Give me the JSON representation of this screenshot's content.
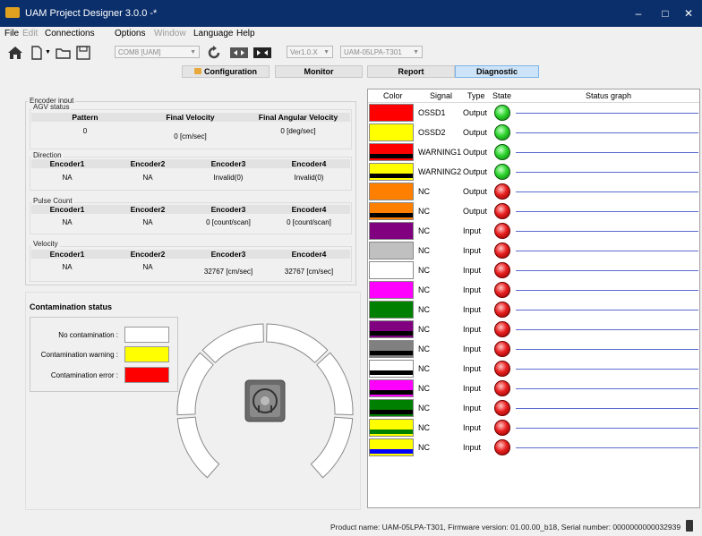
{
  "window": {
    "title": "UAM Project Designer 3.0.0 -*",
    "minimize": "–",
    "maximize": "□",
    "close": "✕"
  },
  "menu": {
    "file": "File",
    "edit": "Edit",
    "connections": "Connections",
    "options": "Options",
    "window": "Window",
    "language": "Language",
    "help": "Help"
  },
  "toolbar": {
    "com_port": "COM8 [UAM]",
    "version": "Ver1.0.X",
    "device": "UAM-05LPA-T301",
    "icons": [
      "home-icon",
      "new-file-icon",
      "open-folder-icon",
      "save-icon",
      "refresh-icon",
      "disconnect-icon",
      "connect-icon"
    ]
  },
  "tabs": {
    "configuration": "Configuration",
    "monitor": "Monitor",
    "report": "Report",
    "diagnostic": "Diagnostic",
    "active": "diagnostic"
  },
  "encoder": {
    "title": "Encoder input",
    "agv": {
      "title": "AGV status",
      "headers": {
        "pattern": "Pattern",
        "velocity": "Final Velocity",
        "angular": "Final Angular Velocity"
      },
      "values": {
        "pattern": "0",
        "velocity": "0 [cm/sec]",
        "angular": "0 [deg/sec]"
      }
    },
    "direction": {
      "title": "Direction",
      "headers": [
        "Encoder1",
        "Encoder2",
        "Encoder3",
        "Encoder4"
      ],
      "values": [
        "NA",
        "NA",
        "Invalid(0)",
        "Invalid(0)"
      ]
    },
    "pulse": {
      "title": "Pulse Count",
      "headers": [
        "Encoder1",
        "Encoder2",
        "Encoder3",
        "Encoder4"
      ],
      "values": [
        "NA",
        "NA",
        "0 [count/scan]",
        "0 [count/scan]"
      ]
    },
    "velocity": {
      "title": "Velocity",
      "headers": [
        "Encoder1",
        "Encoder2",
        "Encoder3",
        "Encoder4"
      ],
      "values": [
        "NA",
        "NA",
        "32767 [cm/sec]",
        "32767 [cm/sec]"
      ]
    }
  },
  "contamination": {
    "title": "Contamination status",
    "legend": [
      {
        "label": "No contamination :",
        "color": "#ffffff"
      },
      {
        "label": "Contamination warning :",
        "color": "#ffff00"
      },
      {
        "label": "Contamination error :",
        "color": "#ff0000"
      }
    ]
  },
  "io_table": {
    "headers": {
      "color": "Color",
      "signal": "Signal",
      "type": "Type",
      "state": "State",
      "graph": "Status graph"
    },
    "rows": [
      {
        "color": "#ff0000",
        "stripe": "",
        "signal": "OSSD1",
        "type": "Output",
        "state": "green"
      },
      {
        "color": "#ffff00",
        "stripe": "",
        "signal": "OSSD2",
        "type": "Output",
        "state": "green"
      },
      {
        "color": "#ff0000",
        "stripe": "#000000",
        "signal": "WARNING1",
        "type": "Output",
        "state": "green"
      },
      {
        "color": "#ffff00",
        "stripe": "#000000",
        "signal": "WARNING2",
        "type": "Output",
        "state": "green"
      },
      {
        "color": "#ff8000",
        "stripe": "",
        "signal": "NC",
        "type": "Output",
        "state": "red"
      },
      {
        "color": "#ff8000",
        "stripe": "#000000",
        "signal": "NC",
        "type": "Output",
        "state": "red"
      },
      {
        "color": "#800080",
        "stripe": "",
        "signal": "NC",
        "type": "Input",
        "state": "red"
      },
      {
        "color": "#c0c0c0",
        "stripe": "",
        "signal": "NC",
        "type": "Input",
        "state": "red"
      },
      {
        "color": "#ffffff",
        "stripe": "",
        "signal": "NC",
        "type": "Input",
        "state": "red"
      },
      {
        "color": "#ff00ff",
        "stripe": "",
        "signal": "NC",
        "type": "Input",
        "state": "red"
      },
      {
        "color": "#008000",
        "stripe": "",
        "signal": "NC",
        "type": "Input",
        "state": "red"
      },
      {
        "color": "#800080",
        "stripe": "#000000",
        "signal": "NC",
        "type": "Input",
        "state": "red"
      },
      {
        "color": "#808080",
        "stripe": "#000000",
        "signal": "NC",
        "type": "Input",
        "state": "red"
      },
      {
        "color": "#ffffff",
        "stripe": "#000000",
        "signal": "NC",
        "type": "Input",
        "state": "red"
      },
      {
        "color": "#ff00ff",
        "stripe": "#000000",
        "signal": "NC",
        "type": "Input",
        "state": "red"
      },
      {
        "color": "#008000",
        "stripe": "#000000",
        "signal": "NC",
        "type": "Input",
        "state": "red"
      },
      {
        "color": "#ffff00",
        "stripe": "#008000",
        "signal": "NC",
        "type": "Input",
        "state": "red"
      },
      {
        "color": "#ffff00",
        "stripe": "#0000ff",
        "signal": "NC",
        "type": "Input",
        "state": "red"
      }
    ]
  },
  "status_bar": {
    "text": "Product name: UAM-05LPA-T301, Firmware version: 01.00.00_b18, Serial number: 0000000000032939"
  }
}
